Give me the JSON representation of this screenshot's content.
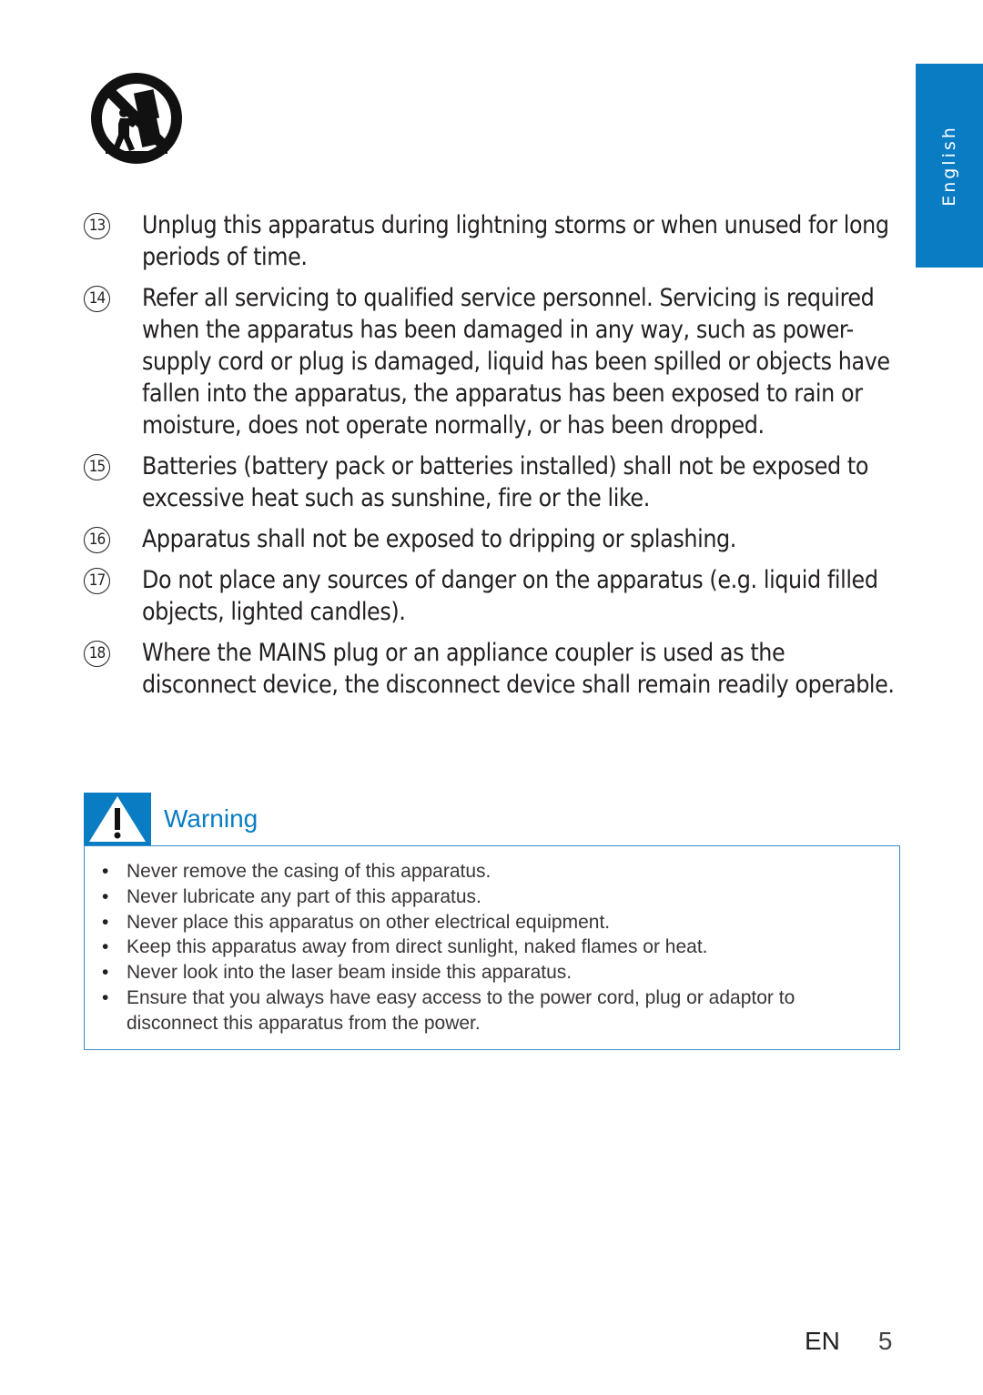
{
  "side_tab": {
    "language": "English"
  },
  "icons": {
    "cart": "no-cart-tipping-icon",
    "warning": "warning-triangle-icon"
  },
  "items": [
    {
      "number": "13",
      "text": "Unplug this apparatus during lightning storms or when unused for long periods of time."
    },
    {
      "number": "14",
      "text": "Refer all servicing to qualified service personnel. Servicing is required when the apparatus has been damaged in any way, such as power-supply cord or plug is damaged, liquid has been spilled or objects have fallen into the apparatus, the apparatus has been exposed to rain or moisture, does not operate normally, or has been dropped."
    },
    {
      "number": "15",
      "text": "Batteries (battery pack or batteries installed) shall not be exposed to excessive heat such as sunshine, fire or the like."
    },
    {
      "number": "16",
      "text": "Apparatus shall not be exposed to dripping or splashing."
    },
    {
      "number": "17",
      "text": "Do not place any sources of danger on the apparatus (e.g. liquid filled objects, lighted candles)."
    },
    {
      "number": "18",
      "text": "Where the MAINS plug or an appliance coupler is used as the disconnect device, the disconnect device shall remain readily operable."
    }
  ],
  "warning": {
    "title": "Warning",
    "bullet": "•",
    "points": [
      "Never remove the casing of this apparatus.",
      "Never lubricate any part of this apparatus.",
      "Never place this apparatus on other electrical equipment.",
      "Keep this apparatus away from direct sunlight, naked flames or heat.",
      "Never look into the laser beam inside this apparatus.",
      "Ensure that you always have easy access to the power cord, plug or adaptor to disconnect this apparatus from the power."
    ]
  },
  "footer": {
    "lang_code": "EN",
    "page_number": "5"
  },
  "colors": {
    "accent": "#0a7cc4",
    "text": "#231f20"
  }
}
